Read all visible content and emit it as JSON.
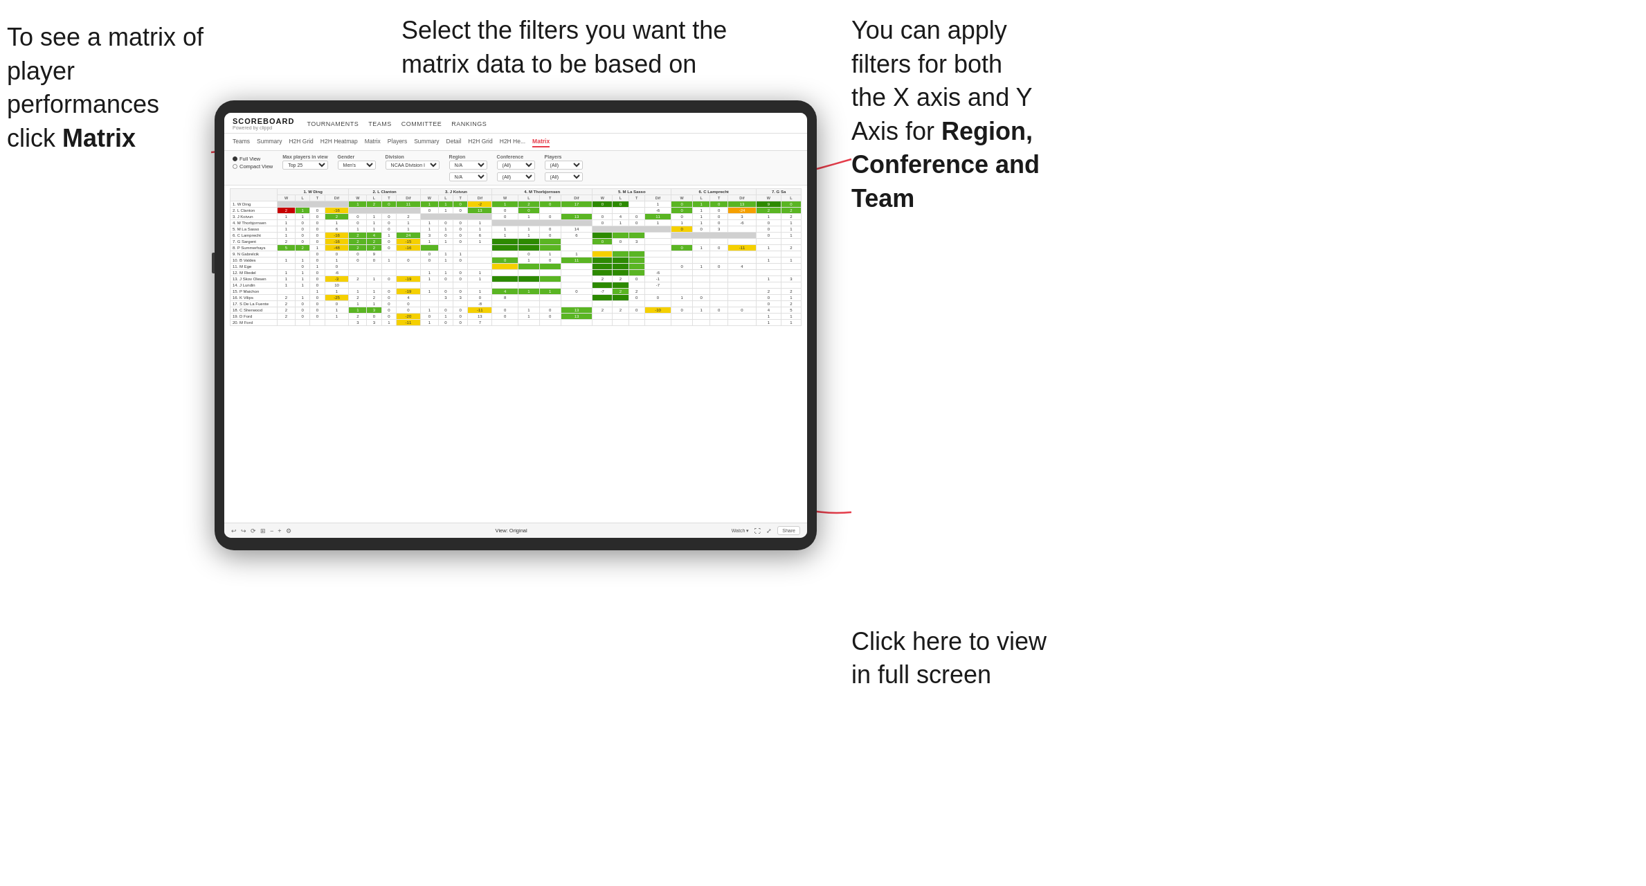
{
  "annotations": {
    "topleft": {
      "line1": "To see a matrix of",
      "line2": "player performances",
      "line3": "click ",
      "line3bold": "Matrix"
    },
    "topmid": {
      "text": "Select the filters you want the matrix data to be based on"
    },
    "topright": {
      "line1": "You  can apply",
      "line2": "filters for both",
      "line3": "the X axis and Y",
      "line4": "Axis for ",
      "line4bold": "Region,",
      "line5bold": "Conference and",
      "line6bold": "Team"
    },
    "bottomright": {
      "line1": "Click here to view",
      "line2": "in full screen"
    }
  },
  "scoreboard": {
    "logo": "SCOREBOARD",
    "logo_sub": "Powered by clippd",
    "nav_items": [
      "TOURNAMENTS",
      "TEAMS",
      "COMMITTEE",
      "RANKINGS"
    ],
    "tabs_main": [
      "Teams",
      "Summary",
      "H2H Grid",
      "H2H Heatmap",
      "Matrix",
      "Players",
      "Summary",
      "Detail",
      "H2H Grid",
      "H2H He...",
      "Matrix"
    ],
    "active_tab": "Matrix",
    "filters": {
      "view_options": [
        "Full View",
        "Compact View"
      ],
      "selected_view": "Full View",
      "max_players_label": "Max players in view",
      "max_players_value": "Top 25",
      "gender_label": "Gender",
      "gender_value": "Men's",
      "division_label": "Division",
      "division_value": "NCAA Division I",
      "region_label": "Region",
      "region_value": "N/A",
      "conference_label": "Conference",
      "conference_value": "(All)",
      "players_label": "Players",
      "players_value": "(All)"
    },
    "column_headers": [
      "1. W Ding",
      "2. L Clanton",
      "3. J Koivun",
      "4. M Thorbjornsen",
      "5. M La Sasso",
      "6. C Lamprecht",
      "7. G Sa"
    ],
    "sub_headers": [
      "W",
      "L",
      "T",
      "Dif"
    ],
    "row_players": [
      "1. W Ding",
      "2. L Clanton",
      "3. J Koivun",
      "4. M Thorbjornsen",
      "5. M La Sasso",
      "6. C Lamprecht",
      "7. G Sargent",
      "8. P Summerhays",
      "9. N Gabrelcik",
      "10. B Valdes",
      "11. M Ege",
      "12. M Riedel",
      "13. J Skov Olesen",
      "14. J Lundin",
      "15. P Maichon",
      "16. K Vilips",
      "17. S De La Fuente",
      "18. C Sherwood",
      "19. D Ford",
      "20. M Ford"
    ],
    "toolbar": {
      "view_label": "View: Original",
      "watch_label": "Watch",
      "share_label": "Share"
    }
  },
  "colors": {
    "accent": "#e63c4a",
    "green_dark": "#2d8a00",
    "green": "#5ab523",
    "green_light": "#a0d060",
    "yellow": "#f5d000",
    "orange": "#f5a000",
    "red": "#c80000",
    "arrow_color": "#e63c4a"
  }
}
